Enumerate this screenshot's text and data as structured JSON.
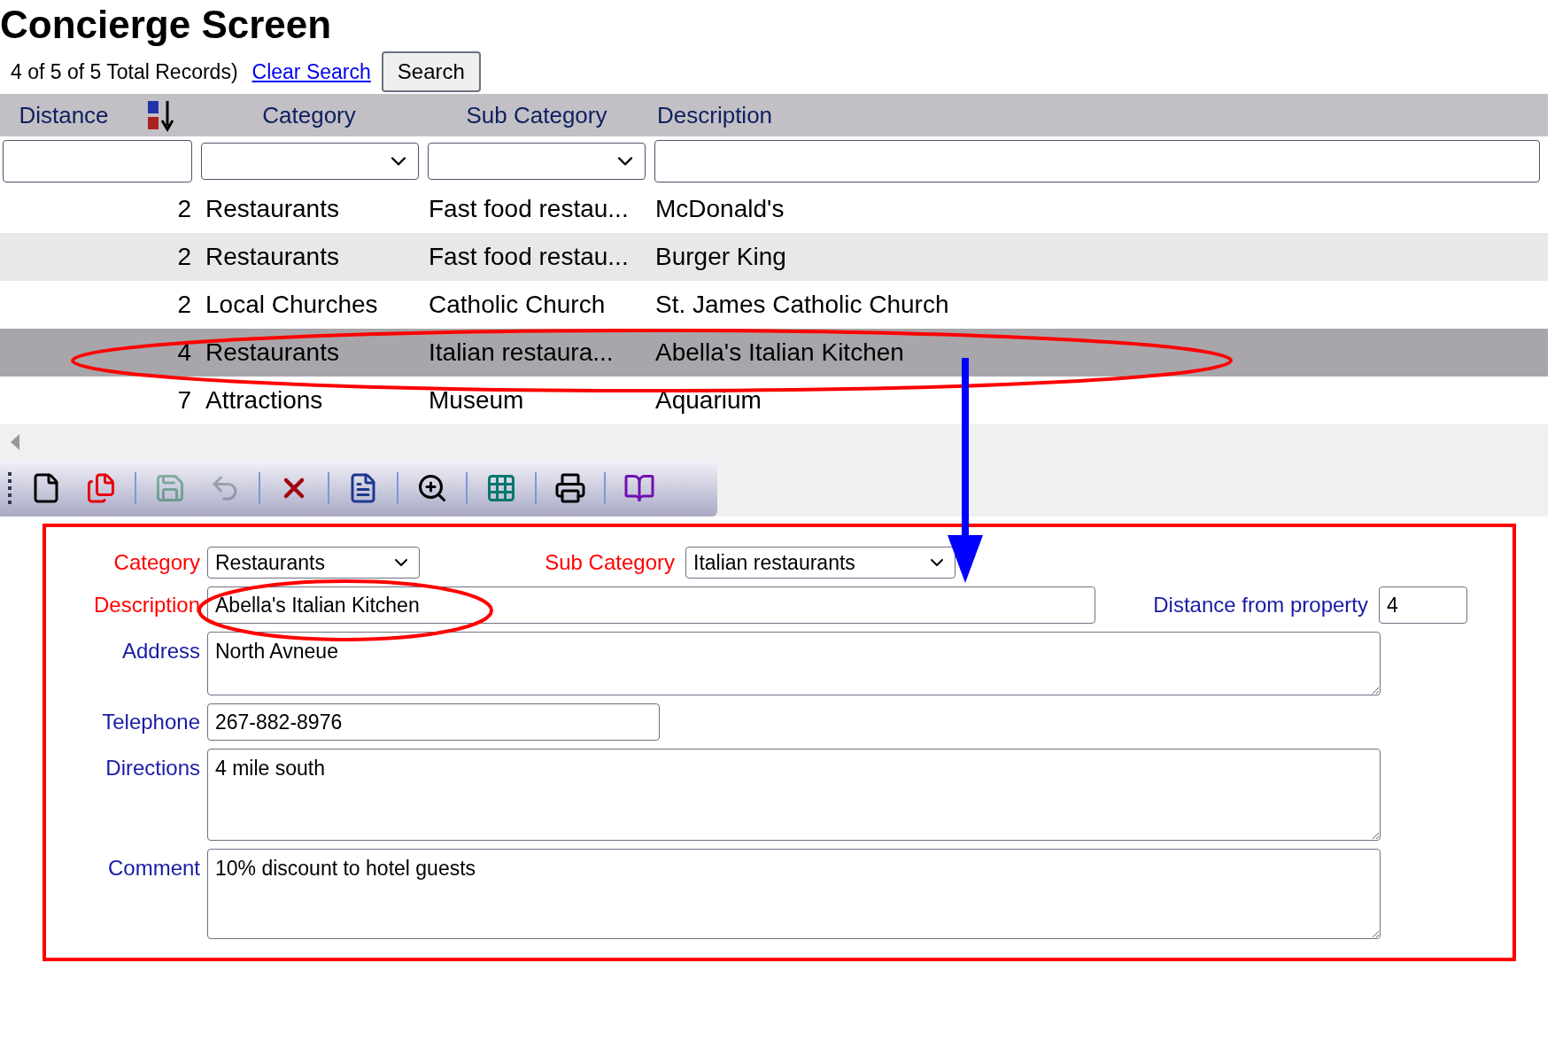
{
  "title": "Concierge Screen",
  "records": "4 of 5 of 5 Total Records)",
  "clear_search": "Clear Search",
  "search_button": "Search",
  "table": {
    "columns": [
      "Distance",
      "Category",
      "Sub Category",
      "Description"
    ],
    "rows": [
      {
        "cells": [
          "2",
          "Restaurants",
          "Fast food restau...",
          "McDonald's"
        ],
        "selected": false
      },
      {
        "cells": [
          "2",
          "Restaurants",
          "Fast food restau...",
          "Burger King"
        ],
        "selected": false
      },
      {
        "cells": [
          "2",
          "Local Churches",
          "Catholic Church",
          "St. James Catholic Church"
        ],
        "selected": false
      },
      {
        "cells": [
          "4",
          "Restaurants",
          "Italian restaura...",
          "Abella's Italian Kitchen"
        ],
        "selected": true
      },
      {
        "cells": [
          "7",
          "Attractions",
          "Museum",
          "Aquarium"
        ],
        "selected": false
      }
    ]
  },
  "toolbar": [
    {
      "kind": "new",
      "disabled": false
    },
    {
      "kind": "copy",
      "disabled": false
    },
    {
      "kind": "save",
      "disabled": true
    },
    {
      "kind": "undo",
      "disabled": true
    },
    {
      "kind": "delete",
      "disabled": false
    },
    {
      "kind": "report",
      "disabled": false
    },
    {
      "kind": "find",
      "disabled": false
    },
    {
      "kind": "grid",
      "disabled": false
    },
    {
      "kind": "print",
      "disabled": false
    },
    {
      "kind": "help",
      "disabled": false
    }
  ],
  "form": {
    "fields": [
      {
        "label": "Category",
        "kind": "select",
        "value": "Restaurants",
        "required": true
      },
      {
        "label": "Sub Category",
        "kind": "select",
        "value": "Italian restaurants",
        "required": true
      },
      {
        "label": "Description",
        "kind": "text",
        "value": "Abella's Italian Kitchen",
        "required": true
      },
      {
        "label": "Distance from property",
        "kind": "text",
        "value": "4",
        "required": false
      },
      {
        "label": "Address",
        "kind": "textarea",
        "value": "North Avneue",
        "required": false
      },
      {
        "label": "Telephone",
        "kind": "text",
        "value": "267-882-8976",
        "required": false
      },
      {
        "label": "Directions",
        "kind": "textarea",
        "value": "4 mile south",
        "required": false
      },
      {
        "label": "Comment",
        "kind": "textarea",
        "value": "10% discount to hotel guests",
        "required": false
      }
    ]
  }
}
